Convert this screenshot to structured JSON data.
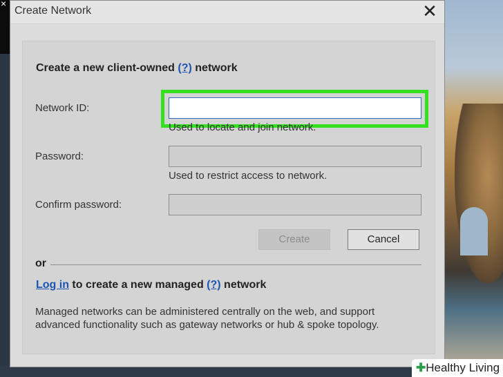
{
  "dialog": {
    "title": "Create Network",
    "close_glyph": "✕"
  },
  "form": {
    "heading_prefix": "Create a new client-owned ",
    "heading_help_link": "(?)",
    "heading_suffix": " network",
    "network_id": {
      "label": "Network ID:",
      "value": "",
      "hint": "Used to locate and join network."
    },
    "password": {
      "label": "Password:",
      "value": "",
      "hint": "Used to restrict access to network."
    },
    "confirm_password": {
      "label": "Confirm password:",
      "value": ""
    },
    "buttons": {
      "create": "Create",
      "cancel": "Cancel"
    }
  },
  "managed": {
    "or_label": "or",
    "login_link": "Log in",
    "text_middle": " to create a new managed ",
    "help_link": "(?)",
    "text_suffix": " network",
    "description": "Managed networks can be administered centrally on the web, and support advanced functionality such as gateway networks or hub & spoke topology."
  },
  "background": {
    "corner_glyph": "×"
  },
  "watermark": {
    "plus": "✚",
    "text": "Healthy Living"
  },
  "colors": {
    "highlight": "#34e01f",
    "link": "#1a55b5"
  }
}
